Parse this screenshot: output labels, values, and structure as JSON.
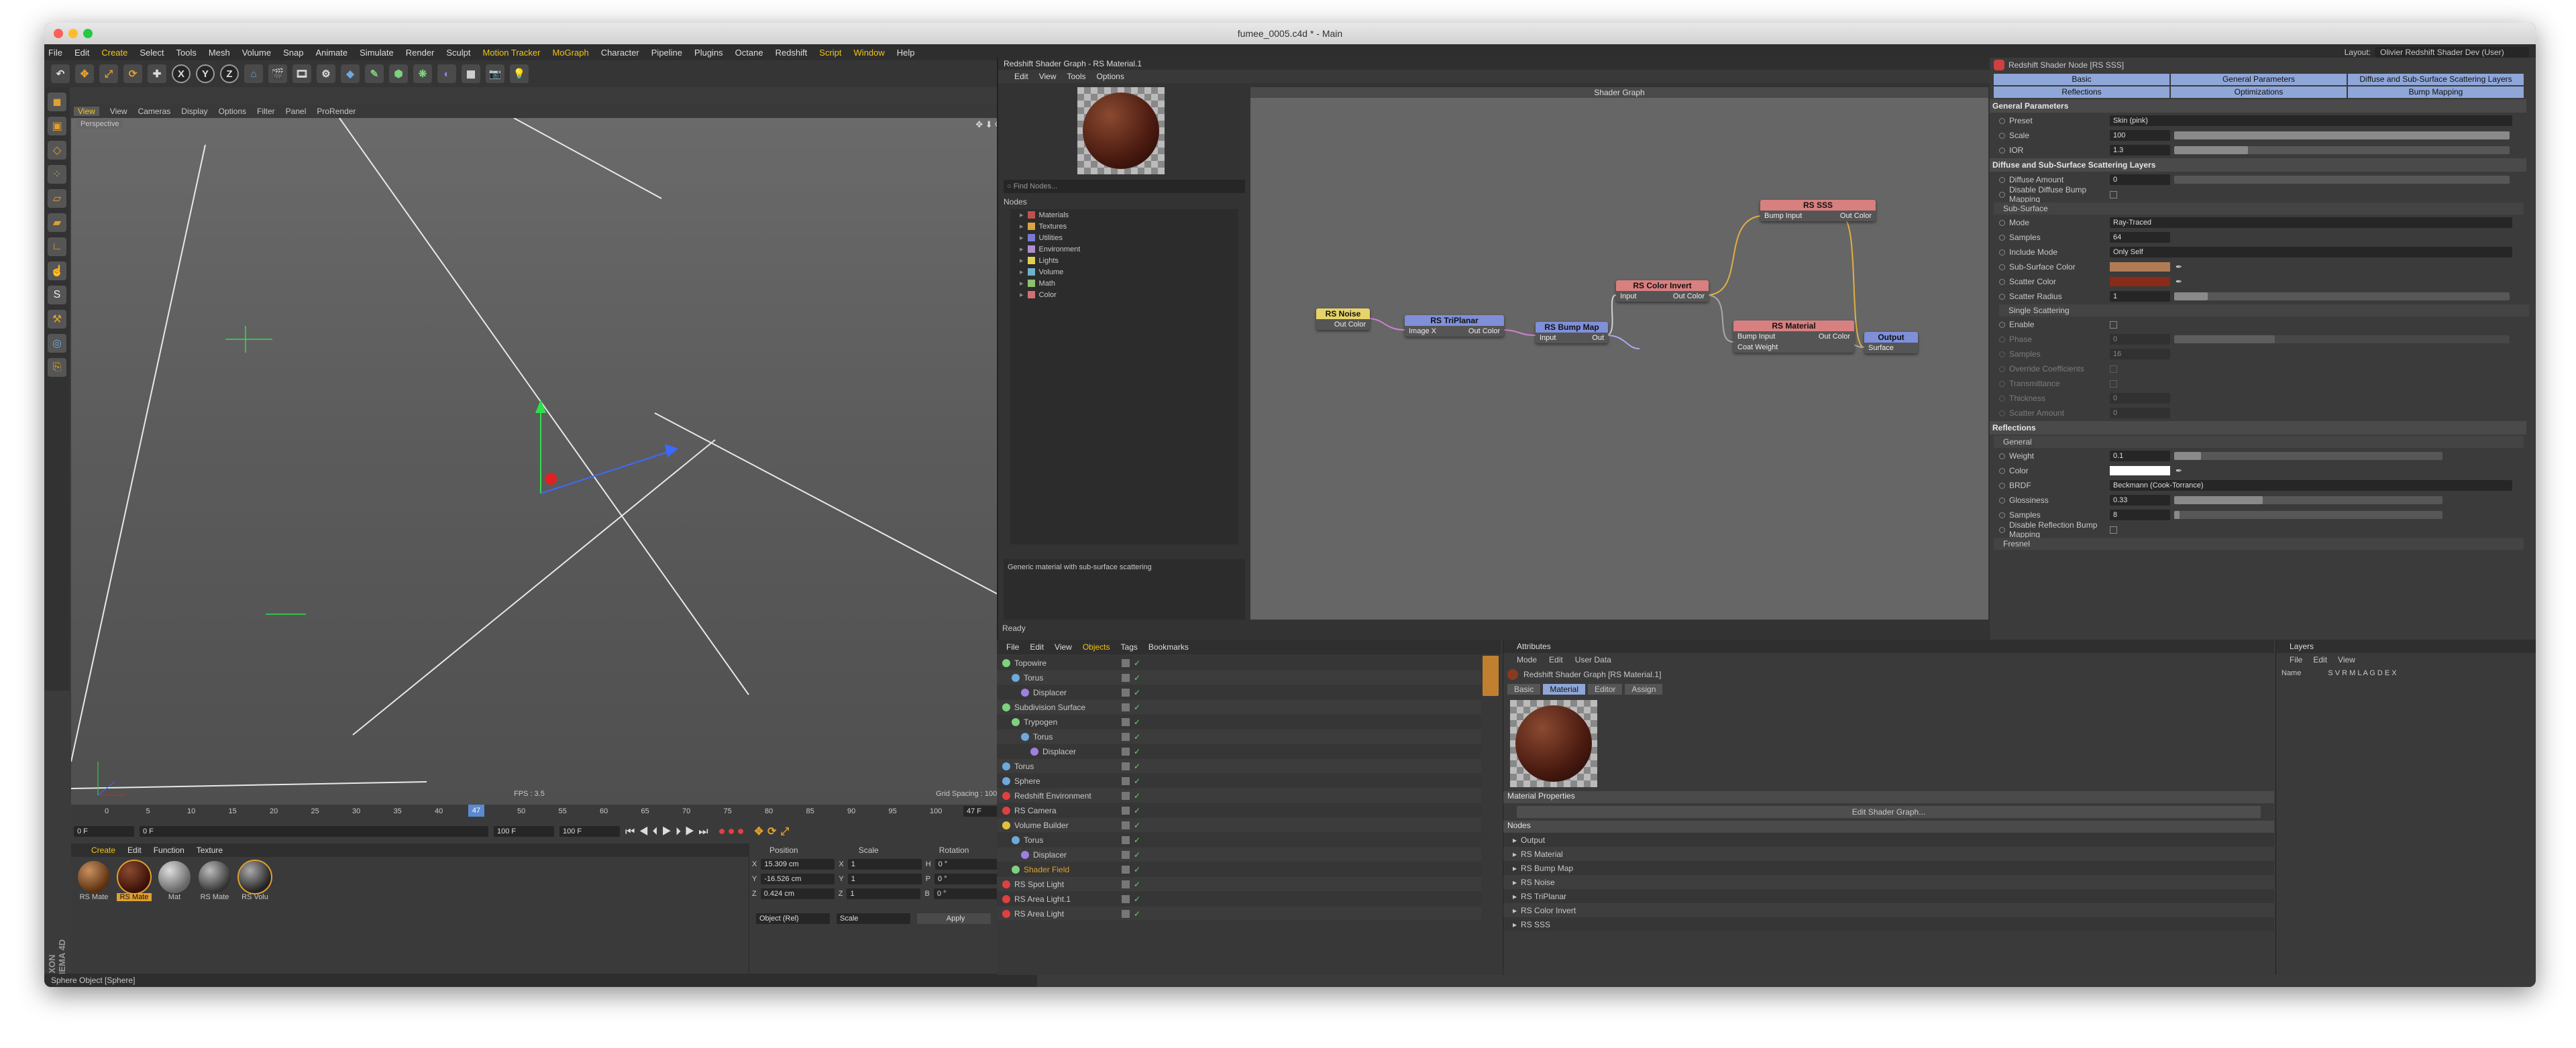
{
  "window": {
    "title": "fumee_0005.c4d * - Main",
    "layout_label": "Layout:",
    "layout_value": "Olivier Redshift Shader Dev (User)"
  },
  "menu": [
    "File",
    "Edit",
    "Create",
    "Select",
    "Tools",
    "Mesh",
    "Volume",
    "Snap",
    "Animate",
    "Simulate",
    "Render",
    "Sculpt",
    "Motion Tracker",
    "MoGraph",
    "Character",
    "Pipeline",
    "Plugins",
    "Octane",
    "Redshift",
    "Script",
    "Window",
    "Help"
  ],
  "toolbar": {
    "axes": [
      "X",
      "Y",
      "Z"
    ]
  },
  "viewport": {
    "tab": "View",
    "menu": [
      "View",
      "Cameras",
      "Display",
      "Options",
      "Filter",
      "Panel",
      "ProRender"
    ],
    "camera_label": "Perspective",
    "fps": "FPS : 3.5",
    "grid_spacing": "Grid Spacing : 100 cm"
  },
  "timeline": {
    "ticks": [
      "0",
      "5",
      "10",
      "15",
      "20",
      "25",
      "30",
      "35",
      "40",
      "45",
      "50",
      "55",
      "60",
      "65",
      "70",
      "75",
      "80",
      "85",
      "90",
      "95",
      "100"
    ],
    "current_frame": "47",
    "frame_field": "47 F",
    "start": "0 F",
    "start2": "0 F",
    "end": "100 F",
    "end2": "100 F"
  },
  "materials": {
    "menu": [
      "Create",
      "Edit",
      "Function",
      "Texture"
    ],
    "items": [
      "RS Mate",
      "RS Mate",
      "Mat",
      "RS Mate",
      "RS Volu"
    ]
  },
  "coords": {
    "headers": [
      "Position",
      "Scale",
      "Rotation"
    ],
    "rows": [
      {
        "axis": "X",
        "pos": "15.309 cm",
        "scale": "1",
        "rot_label": "H",
        "rot": "0 °"
      },
      {
        "axis": "Y",
        "pos": "-16.526 cm",
        "scale": "1",
        "rot_label": "P",
        "rot": "0 °"
      },
      {
        "axis": "Z",
        "pos": "0.424 cm",
        "scale": "1",
        "rot_label": "B",
        "rot": "0 °"
      }
    ],
    "mode": "Object (Rel)",
    "mode2": "Scale",
    "apply": "Apply"
  },
  "status_bar": "Sphere Object [Sphere]",
  "brand": "MAXON CINEMA 4D",
  "shader_window": {
    "title": "Redshift Shader Graph - RS Material.1",
    "menu": [
      "Edit",
      "View",
      "Tools",
      "Options"
    ],
    "find_placeholder": "Find Nodes...",
    "nodes_header": "Nodes",
    "categories": [
      {
        "name": "Materials",
        "color": "#c0504d"
      },
      {
        "name": "Textures",
        "color": "#d9a441"
      },
      {
        "name": "Utilities",
        "color": "#7a7ad0"
      },
      {
        "name": "Environment",
        "color": "#b08fd0"
      },
      {
        "name": "Lights",
        "color": "#e0d050"
      },
      {
        "name": "Volume",
        "color": "#6fb0d0"
      },
      {
        "name": "Math",
        "color": "#8fbf6f"
      },
      {
        "name": "Color",
        "color": "#d07070"
      }
    ],
    "description": "Generic material with sub-surface scattering",
    "graph_title": "Shader Graph",
    "status": "Ready",
    "nodes": [
      {
        "id": "noise",
        "title": "RS Noise",
        "color": "#e6d36a",
        "outs": [
          "Out Color"
        ],
        "ins": []
      },
      {
        "id": "triplanar",
        "title": "RS TriPlanar",
        "color": "#7f8fd8",
        "ins": [
          "Image X"
        ],
        "outs": [
          "Out Color"
        ]
      },
      {
        "id": "bump",
        "title": "RS Bump Map",
        "color": "#7f8fd8",
        "ins": [
          "Input"
        ],
        "outs": [
          "Out"
        ]
      },
      {
        "id": "invert",
        "title": "RS Color Invert",
        "color": "#d87f7f",
        "ins": [
          "Input"
        ],
        "outs": [
          "Out Color"
        ]
      },
      {
        "id": "sss",
        "title": "RS SSS",
        "color": "#d87f7f",
        "ins": [
          "Bump Input"
        ],
        "outs": [
          "Out Color"
        ]
      },
      {
        "id": "material",
        "title": "RS Material",
        "color": "#d87f7f",
        "ins": [
          "Bump Input",
          "Coat Weight"
        ],
        "outs": [
          "Out Color"
        ]
      },
      {
        "id": "output",
        "title": "Output",
        "color": "#7f8fd8",
        "ins": [
          "Surface"
        ],
        "outs": []
      }
    ]
  },
  "node_props": {
    "title": "Redshift Shader Node [RS SSS]",
    "tabs": [
      "Basic",
      "General Parameters",
      "Diffuse and Sub-Surface Scattering Layers",
      "Reflections",
      "Optimizations",
      "Bump Mapping"
    ],
    "general": {
      "header": "General Parameters",
      "preset_label": "Preset",
      "preset": "Skin (pink)",
      "scale_label": "Scale",
      "scale": "100",
      "ior_label": "IOR",
      "ior": "1.3"
    },
    "diffuse": {
      "header": "Diffuse and Sub-Surface Scattering Layers",
      "amount_label": "Diffuse Amount",
      "amount": "0",
      "disable_label": "Disable Diffuse Bump Mapping"
    },
    "subsurface": {
      "header": "Sub-Surface",
      "mode_label": "Mode",
      "mode": "Ray-Traced",
      "samples_label": "Samples",
      "samples": "64",
      "include_label": "Include Mode",
      "include": "Only Self",
      "ss_color_label": "Sub-Surface Color",
      "ss_color": "#b07a55",
      "scatter_color_label": "Scatter Color",
      "scatter_color": "#8a2a18",
      "radius_label": "Scatter Radius",
      "radius": "1"
    },
    "single": {
      "header": "Single Scattering",
      "items": [
        {
          "label": "Enable",
          "value": ""
        },
        {
          "label": "Phase",
          "value": "0"
        },
        {
          "label": "Samples",
          "value": "16"
        },
        {
          "label": "Override Coefficients",
          "value": ""
        },
        {
          "label": "Transmittance",
          "value": ""
        },
        {
          "label": "Thickness",
          "value": "0"
        },
        {
          "label": "Scatter Amount",
          "value": "0"
        }
      ]
    },
    "reflections": {
      "header": "Reflections",
      "general": "General",
      "weight_label": "Weight",
      "weight": "0.1",
      "color_label": "Color",
      "brdf_label": "BRDF",
      "brdf": "Beckmann (Cook-Torrance)",
      "gloss_label": "Glossiness",
      "gloss": "0.33",
      "samples_label": "Samples",
      "samples": "8",
      "disable_label": "Disable Reflection Bump Mapping",
      "fresnel": "Fresnel"
    }
  },
  "objects": {
    "tabs": [
      "File",
      "Edit",
      "View",
      "Objects",
      "Tags",
      "Bookmarks"
    ],
    "rows": [
      {
        "name": "Topowire",
        "indent": 0,
        "type": "gen"
      },
      {
        "name": "Torus",
        "indent": 1,
        "type": "prim"
      },
      {
        "name": "Displacer",
        "indent": 2,
        "type": "def"
      },
      {
        "name": "Subdivision Surface",
        "indent": 0,
        "type": "gen"
      },
      {
        "name": "Trypogen",
        "indent": 1,
        "type": "gen"
      },
      {
        "name": "Torus",
        "indent": 2,
        "type": "prim"
      },
      {
        "name": "Displacer",
        "indent": 3,
        "type": "def"
      },
      {
        "name": "Torus",
        "indent": 0,
        "type": "prim"
      },
      {
        "name": "Sphere",
        "indent": 0,
        "type": "prim"
      },
      {
        "name": "Redshift Environment",
        "indent": 0,
        "type": "rs"
      },
      {
        "name": "RS Camera",
        "indent": 0,
        "type": "rs"
      },
      {
        "name": "Volume Builder",
        "indent": 0,
        "type": "vol"
      },
      {
        "name": "Torus",
        "indent": 1,
        "type": "prim"
      },
      {
        "name": "Displacer",
        "indent": 2,
        "type": "def"
      },
      {
        "name": "Shader Field",
        "indent": 1,
        "type": "field"
      },
      {
        "name": "RS Spot Light",
        "indent": 0,
        "type": "rs"
      },
      {
        "name": "RS Area Light.1",
        "indent": 0,
        "type": "rs"
      },
      {
        "name": "RS Area Light",
        "indent": 0,
        "type": "rs"
      }
    ]
  },
  "attributes": {
    "header": "Attributes",
    "menu": [
      "Mode",
      "Edit",
      "User Data"
    ],
    "object": "Redshift Shader Graph [RS Material.1]",
    "tabs": [
      "Basic",
      "Material",
      "Editor",
      "Assign"
    ],
    "mat_props": "Material Properties",
    "edit_button": "Edit Shader Graph...",
    "nodes_header": "Nodes",
    "nodes": [
      "Output",
      "RS Material",
      "RS Bump Map",
      "RS Noise",
      "RS TriPlanar",
      "RS Color Invert",
      "RS SSS"
    ]
  },
  "layers": {
    "header": "Layers",
    "menu": [
      "File",
      "Edit",
      "View"
    ],
    "name_label": "Name",
    "flags": "S V R M L A G D E X"
  }
}
